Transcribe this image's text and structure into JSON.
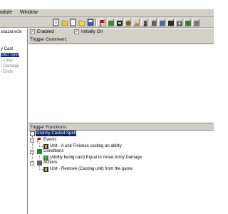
{
  "menu": {
    "items": [
      "odule",
      "Window"
    ]
  },
  "toolbar": {
    "buttons": [
      "new-trigger",
      "new-folder",
      "new-comment",
      "open",
      "save",
      "flag",
      "variable",
      "cut-scene",
      "object",
      "terrain",
      "unit",
      "item",
      "sound",
      "ai",
      "camera",
      "import",
      "test"
    ]
  },
  "left_panel": {
    "nodes": [
      {
        "label": "ssazar.w3x",
        "selected": false
      },
      {
        "label": "y Cast",
        "selected": false
      },
      {
        "label": "cted Spell",
        "selected": true
      },
      {
        "label": "/ Loop",
        "selected": false
      },
      {
        "label": "/ Damage",
        "selected": false
      },
      {
        "label": "/ Ends",
        "selected": false
      }
    ]
  },
  "options": {
    "enabled_label": "Enabled",
    "enabled_checked": true,
    "initially_on_label": "Initially On",
    "initially_on_checked": true
  },
  "comment": {
    "label": "Trigger Comment:"
  },
  "functions": {
    "label": "Trigger Functions:",
    "root": "Granny Casted Spell",
    "events_label": "Events",
    "event_item": "Unit - A unit Finishes casting an ability",
    "conditions_label": "Conditions",
    "condition_item": "(Ability being cast) Equal to Great Army Damage",
    "actions_label": "Actions",
    "action_item": "Unit - Remove (Casting unit) from the game"
  },
  "colors": {
    "panel": "#d4d0c8",
    "selection": "#0a246a",
    "events": "#c00000",
    "conditions": "#2f7f2f",
    "actions": "#606060"
  }
}
